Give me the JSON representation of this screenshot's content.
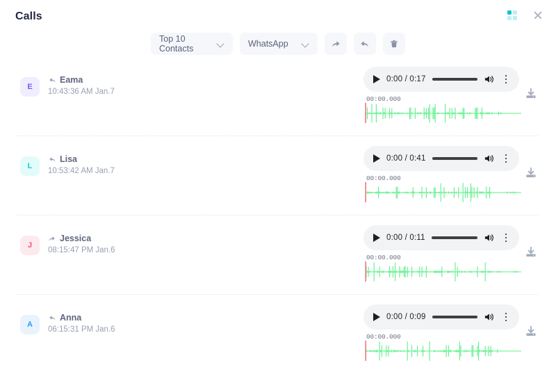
{
  "header": {
    "title": "Calls",
    "apps_icon": "apps-grid-icon",
    "close_icon": "close-icon"
  },
  "toolbar": {
    "contacts_filter": {
      "value": "Top 10 Contacts",
      "icon": "chevron-down-icon"
    },
    "source_filter": {
      "value": "WhatsApp",
      "icon": "chevron-down-icon"
    },
    "forward_button": {
      "icon": "forward-arrow-icon"
    },
    "reply_button": {
      "icon": "reply-arrow-icon"
    },
    "delete_button": {
      "icon": "trash-icon"
    }
  },
  "player_defaults": {
    "play_icon": "play-icon",
    "volume_icon": "volume-icon",
    "menu_icon": "kebab-menu-icon",
    "download_icon": "download-icon",
    "wave_start_label": "00:00.000"
  },
  "colors": {
    "accent_teal": "#19c2cf",
    "waveform_green": "#5ef08a",
    "playhead_red": "#f4737b",
    "player_bg": "#f1f3f4",
    "title": "#232742"
  },
  "calls": [
    {
      "avatar_letter": "E",
      "avatar_fg": "#7b5cf0",
      "avatar_bg": "#f0edfe",
      "name": "Eama",
      "timestamp": "10:43:36 AM Jan.7",
      "direction": "incoming",
      "direction_icon": "incoming-call-arrow-icon",
      "current_time": "0:00",
      "duration": "0:17",
      "timecode": "0:00 / 0:17",
      "wave_start_label": "00:00.000"
    },
    {
      "avatar_letter": "L",
      "avatar_fg": "#22c7c7",
      "avatar_bg": "#e2fbfb",
      "name": "Lisa",
      "timestamp": "10:53:42 AM Jan.7",
      "direction": "incoming",
      "direction_icon": "incoming-call-arrow-icon",
      "current_time": "0:00",
      "duration": "0:41",
      "timecode": "0:00 / 0:41",
      "wave_start_label": "00:00.000"
    },
    {
      "avatar_letter": "J",
      "avatar_fg": "#f2556b",
      "avatar_bg": "#fdeaee",
      "name": "Jessica",
      "timestamp": "08:15:47 PM Jan.6",
      "direction": "outgoing",
      "direction_icon": "outgoing-call-arrow-icon",
      "current_time": "0:00",
      "duration": "0:11",
      "timecode": "0:00 / 0:11",
      "wave_start_label": "00:00.000"
    },
    {
      "avatar_letter": "A",
      "avatar_fg": "#2f9bf5",
      "avatar_bg": "#e8f3fe",
      "name": "Anna",
      "timestamp": "06:15:31 PM Jan.6",
      "direction": "incoming",
      "direction_icon": "incoming-call-arrow-icon",
      "current_time": "0:00",
      "duration": "0:09",
      "timecode": "0:00 / 0:09",
      "wave_start_label": "00:00.000"
    }
  ]
}
